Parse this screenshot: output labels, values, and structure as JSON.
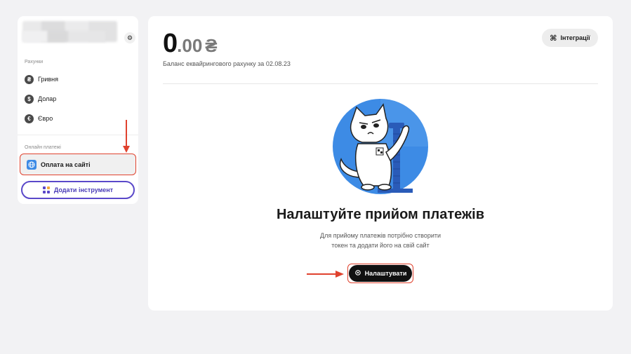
{
  "sidebar": {
    "accounts_label": "Рахунки",
    "accounts": [
      {
        "label": "Гривня",
        "icon": "hryvnia-icon",
        "glyph": "₴"
      },
      {
        "label": "Долар",
        "icon": "dollar-icon",
        "glyph": "$"
      },
      {
        "label": "Євро",
        "icon": "euro-icon",
        "glyph": "€"
      }
    ],
    "online_label": "Онлайн платежі",
    "online_item": "Оплата на сайті",
    "add_button": "Додати інструмент"
  },
  "main": {
    "balance_int": "0",
    "balance_dec": ".00",
    "currency": "₴",
    "balance_caption": "Баланс еквайрингового рахунку за 02.08.23",
    "integrations_button": "Інтеграції",
    "headline": "Налаштуйте прийом платежів",
    "desc_line1": "Для прийому платежів потрібно створити",
    "desc_line2": "токен та додати його на свій сайт",
    "setup_button": "Налаштувати"
  },
  "colors": {
    "accent_red": "#e0422e",
    "button_purple": "#5a48c9",
    "illustration_blue": "#3d8be5"
  }
}
